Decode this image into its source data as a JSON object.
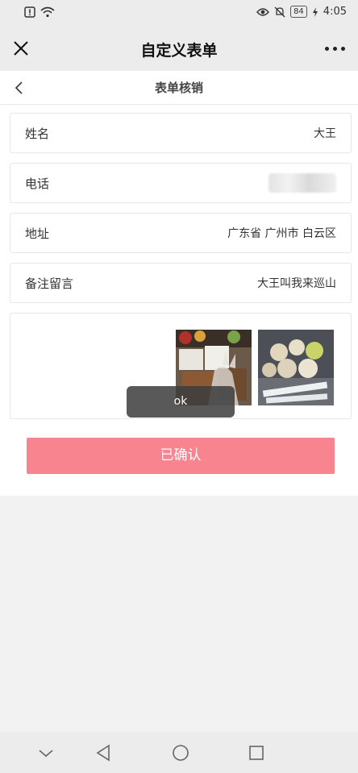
{
  "status_bar": {
    "time": "4:05",
    "battery": "84",
    "icons": [
      "alert-icon",
      "wifi-icon",
      "eye-icon",
      "mute-icon",
      "charging-icon"
    ]
  },
  "app_bar": {
    "title": "自定义表单",
    "close_icon": "close-icon",
    "more_icon": "more-icon"
  },
  "sub_bar": {
    "title": "表单核销",
    "back_icon": "back-icon"
  },
  "form": {
    "rows": [
      {
        "label": "姓名",
        "value": "大王"
      },
      {
        "label": "电话",
        "value": ""
      },
      {
        "label": "地址",
        "value": "广东省 广州市 白云区"
      },
      {
        "label": "备注留言",
        "value": "大王叫我来巡山"
      }
    ]
  },
  "toast": {
    "text": "ok"
  },
  "confirm_button": {
    "label": "已确认",
    "color": "#f7848f"
  },
  "nav_bar": {
    "icons": [
      "chevron-down-icon",
      "back-triangle-icon",
      "home-circle-icon",
      "recents-square-icon"
    ]
  }
}
